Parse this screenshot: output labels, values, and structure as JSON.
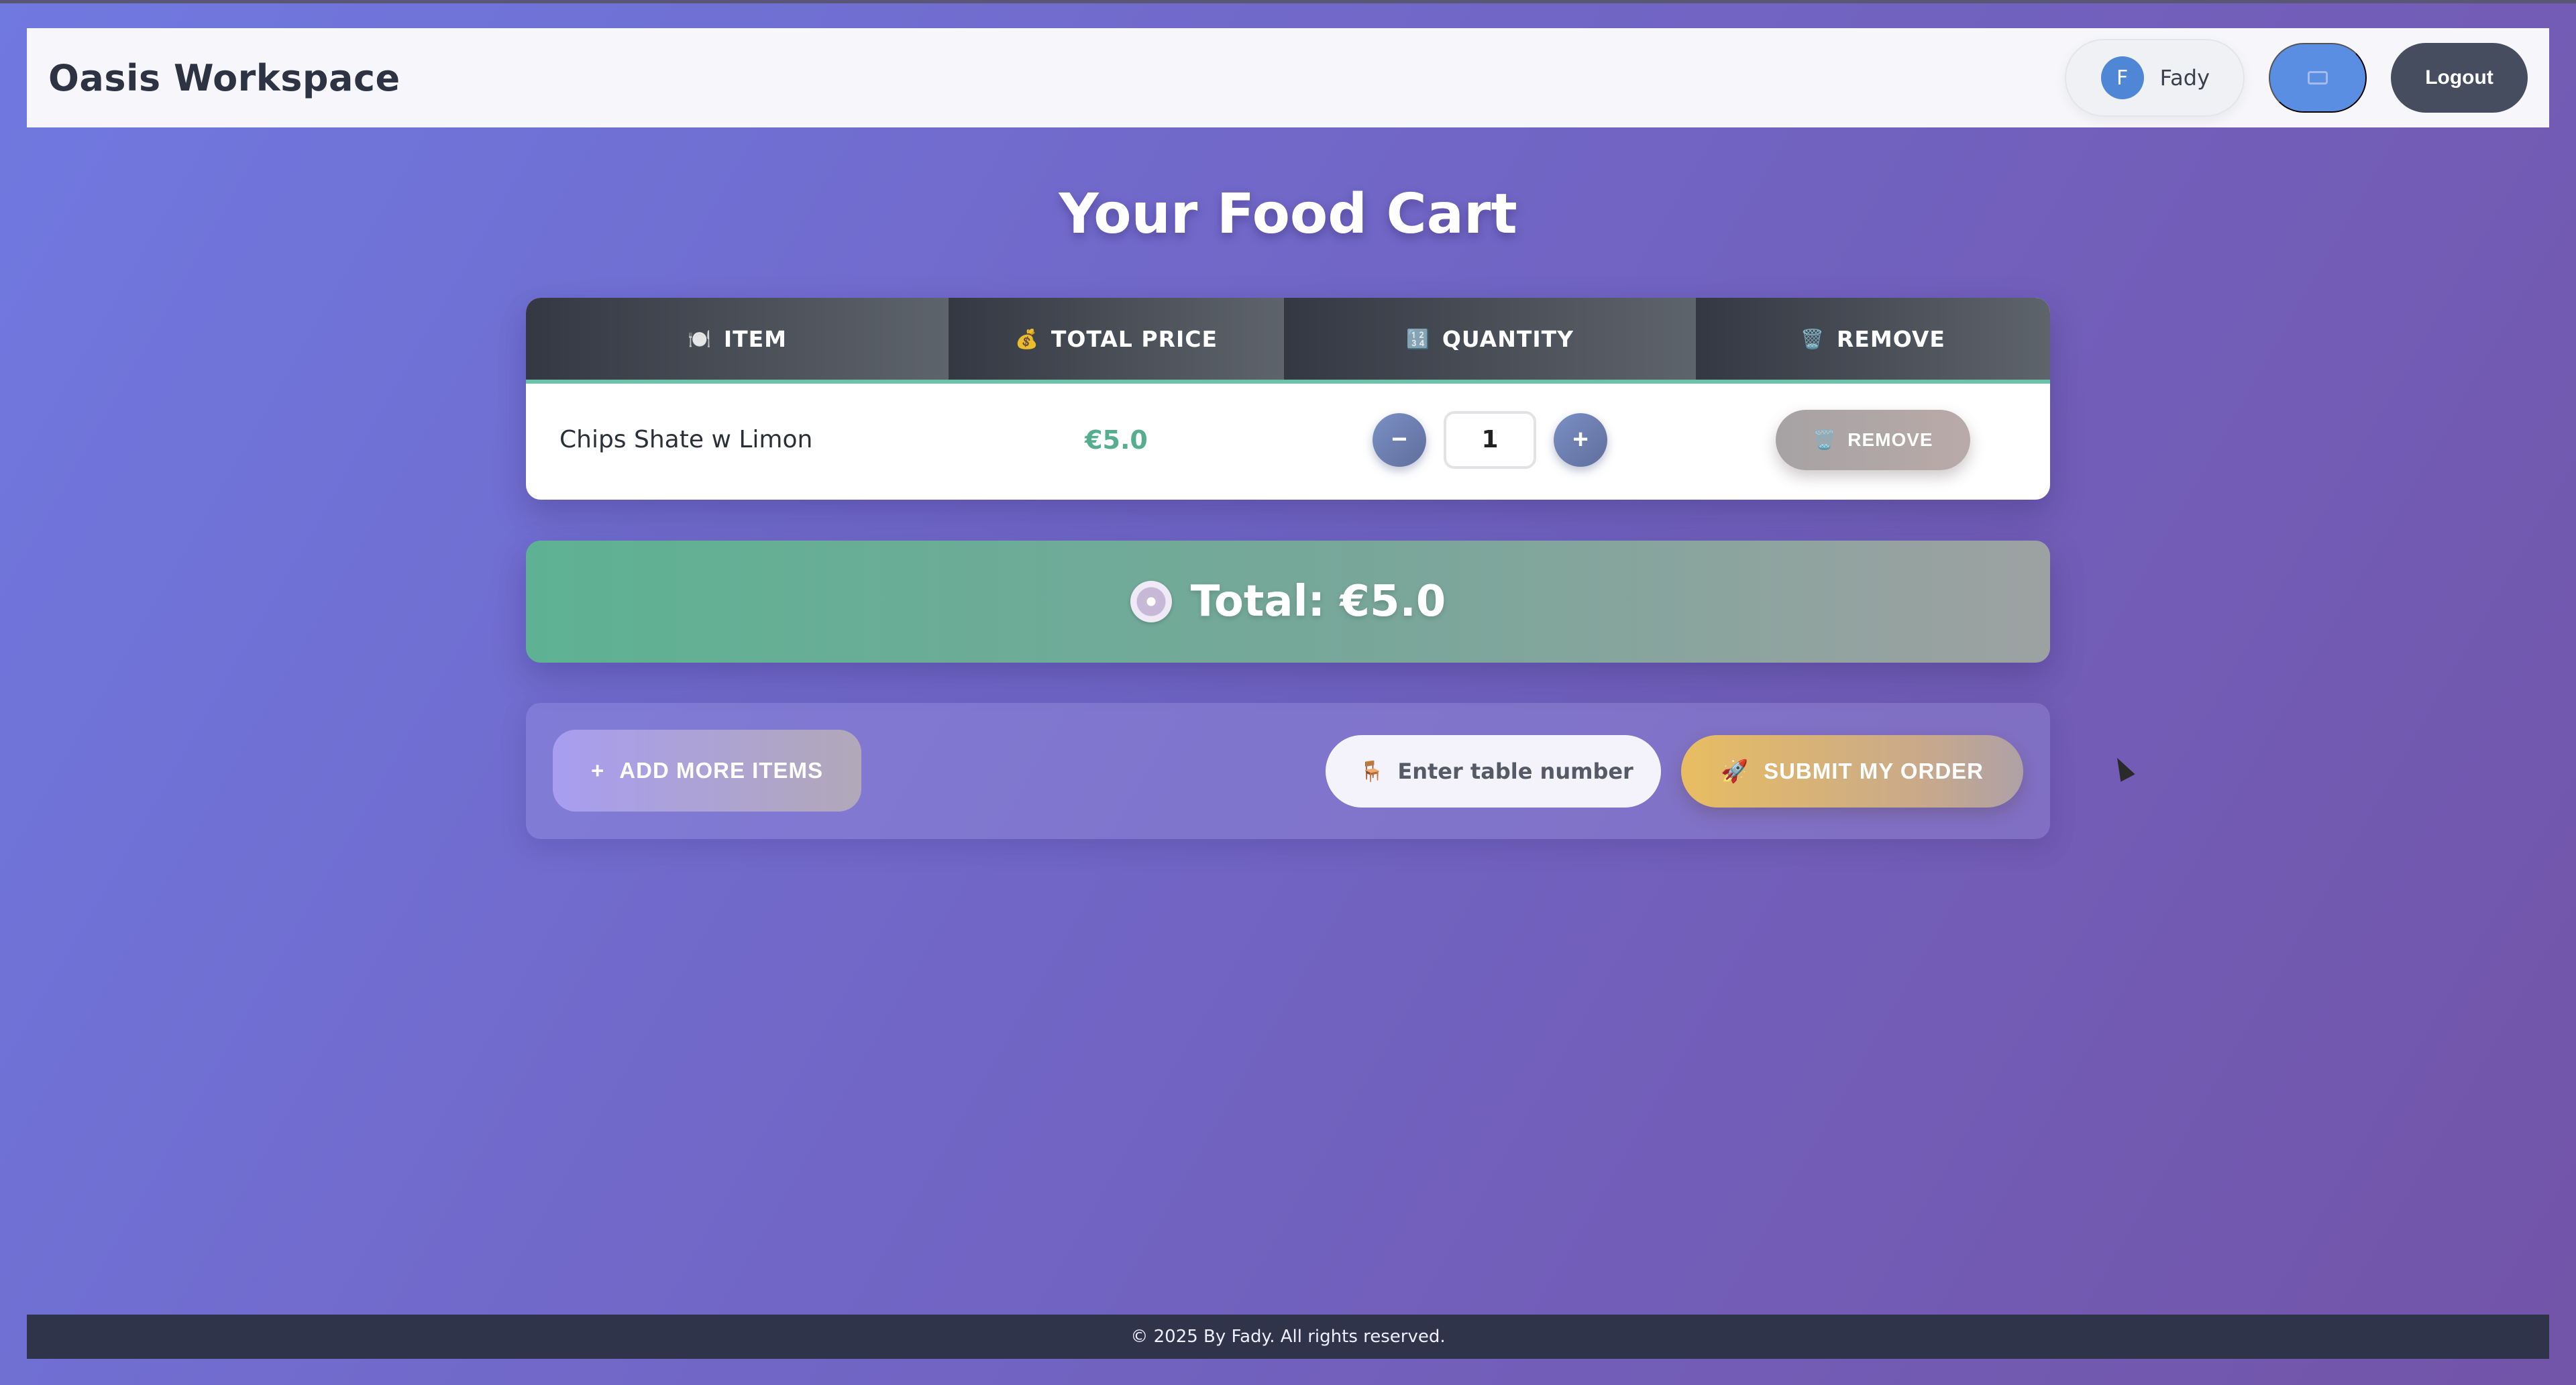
{
  "header": {
    "brand": "Oasis Workspace",
    "user_initial": "F",
    "user_name": "Fady",
    "icon_button": "keyboard-icon",
    "logout_label": "Logout"
  },
  "page": {
    "title": "Your Food Cart"
  },
  "cart": {
    "columns": [
      {
        "icon": "🍽️",
        "label": "ITEM"
      },
      {
        "icon": "💰",
        "label": "TOTAL PRICE"
      },
      {
        "icon": "🔢",
        "label": "QUANTITY"
      },
      {
        "icon": "🗑️",
        "label": "REMOVE"
      }
    ],
    "rows": [
      {
        "item": "Chips Shate w Limon",
        "price": "€5.0",
        "quantity": "1",
        "minus": "−",
        "plus": "+",
        "remove_icon": "🗑️",
        "remove_label": "REMOVE"
      }
    ]
  },
  "total": {
    "icon": "disc-icon",
    "text": "Total: €5.0"
  },
  "actions": {
    "add_icon": "+",
    "add_label": "ADD MORE ITEMS",
    "table_icon": "🪑",
    "table_placeholder": "Enter table number",
    "submit_icon": "🚀",
    "submit_label": "SUBMIT MY ORDER"
  },
  "footer": {
    "text": "© 2025 By Fady. All rights reserved."
  },
  "colors": {
    "accent_price": "#55ae90",
    "header_btn": "#5a8ee2",
    "logout": "#454d5f",
    "footer": "#30344a"
  }
}
